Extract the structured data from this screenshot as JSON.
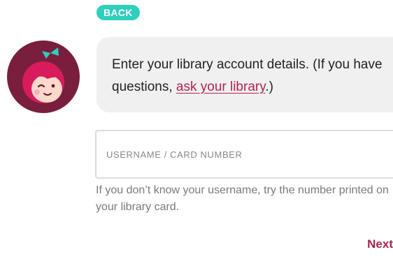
{
  "back_label": "BACK",
  "prompt": {
    "text_before": "Enter your library account details. (If you have questions, ",
    "link_text": "ask your library",
    "text_after": ".)"
  },
  "username": {
    "placeholder": "USERNAME / CARD NUMBER",
    "value": ""
  },
  "help_text": "If you don’t know your username, try the number printed on your library card.",
  "next_label": "Next",
  "colors": {
    "accent_teal": "#2ecfbb",
    "brand_maroon": "#a8244f",
    "link": "#b02352",
    "avatar_bg": "#7a1e3d"
  },
  "icons": {
    "avatar": "libby-avatar-icon"
  }
}
